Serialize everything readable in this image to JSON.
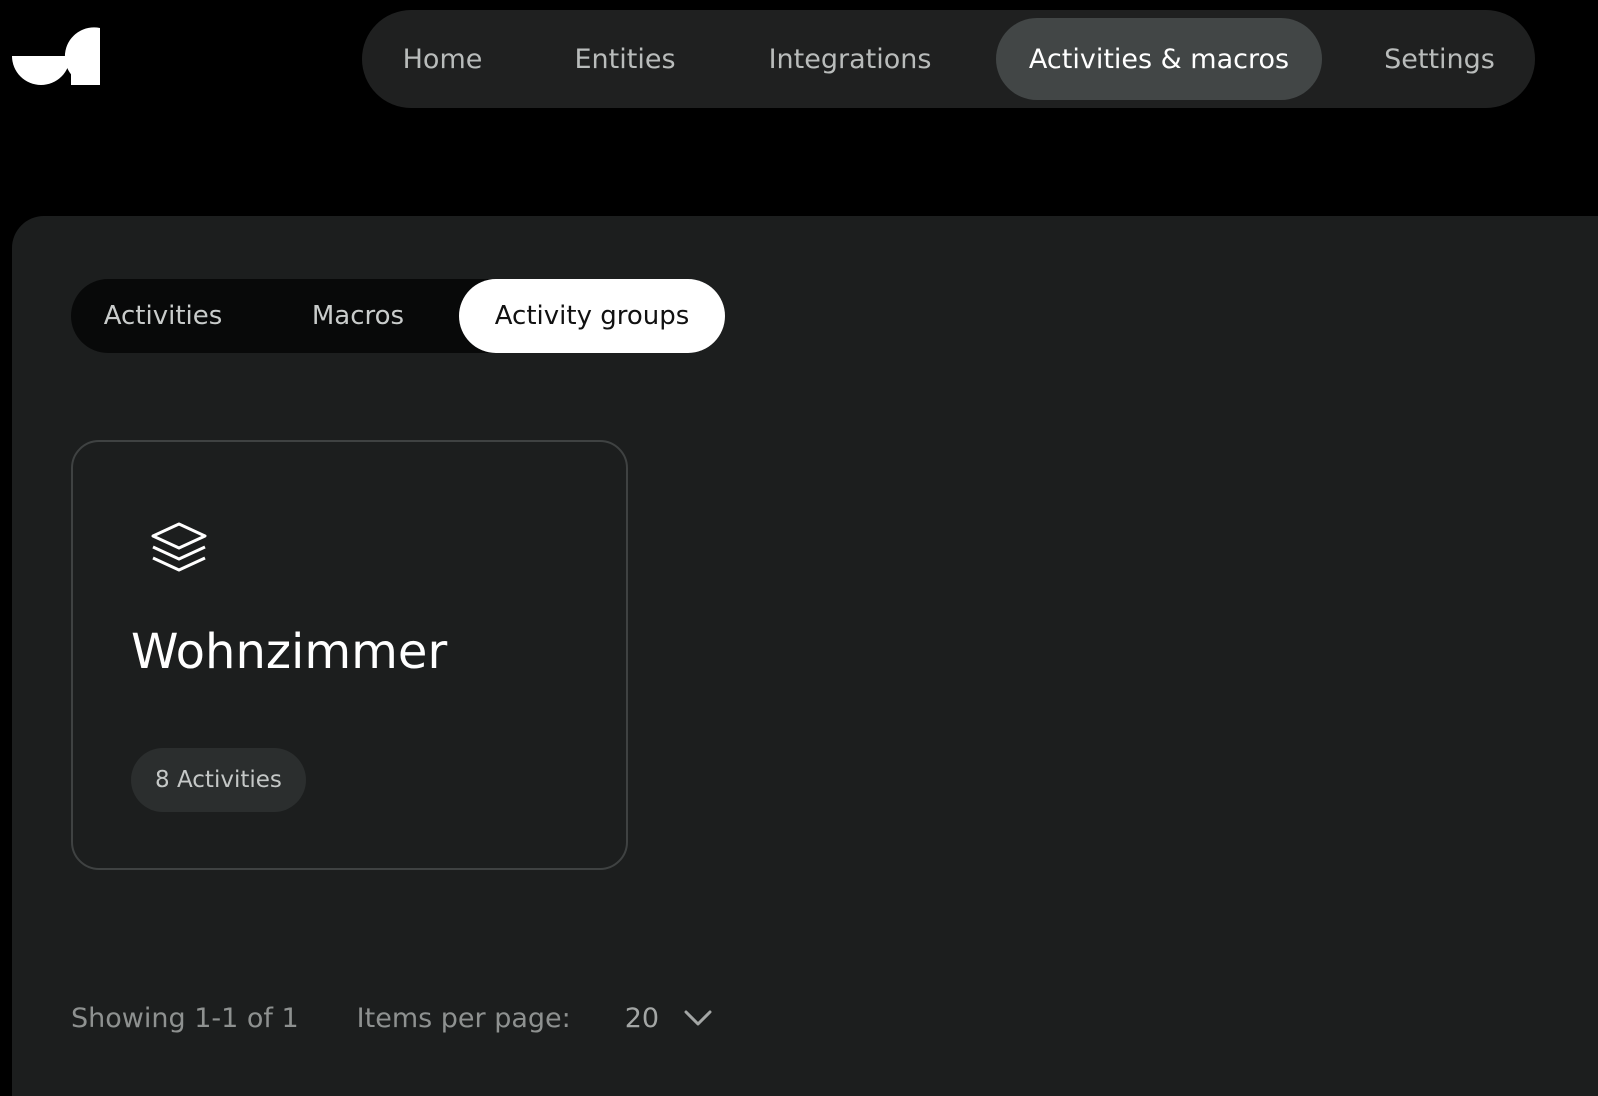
{
  "nav": {
    "items": [
      {
        "label": "Home"
      },
      {
        "label": "Entities"
      },
      {
        "label": "Integrations"
      },
      {
        "label": "Activities & macros"
      },
      {
        "label": "Settings"
      }
    ],
    "active_index": 3
  },
  "tabs": {
    "items": [
      {
        "label": "Activities"
      },
      {
        "label": "Macros"
      },
      {
        "label": "Activity groups"
      }
    ],
    "active_index": 2
  },
  "groups": [
    {
      "name": "Wohnzimmer",
      "badge": "8 Activities",
      "icon": "layers-icon"
    }
  ],
  "pagination": {
    "showing": "Showing 1-1 of 1",
    "items_per_page_label": "Items per page:",
    "items_per_page_value": "20"
  },
  "colors": {
    "background": "#000000",
    "panel": "#1c1e1e",
    "nav_bg": "#1f2020",
    "nav_active": "#424646",
    "tab_active": "#ffffff"
  }
}
